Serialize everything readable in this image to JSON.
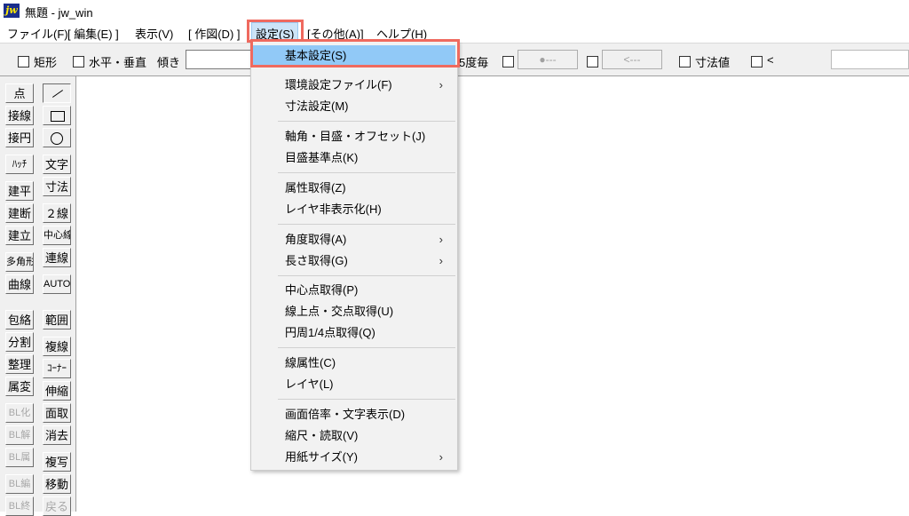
{
  "window": {
    "title": "無題 - jw_win",
    "icon": "jw-app-icon",
    "icon_text": "jw"
  },
  "menubar": {
    "items": [
      {
        "label": "ファイル(F)"
      },
      {
        "label": "[ 編集(E) ]"
      },
      {
        "label": "表示(V)"
      },
      {
        "label": "[ 作図(D) ]"
      },
      {
        "label": "設定(S)"
      },
      {
        "label": "[その他(A)]"
      },
      {
        "label": "ヘルプ(H)"
      }
    ]
  },
  "toolbar": {
    "rect_label": "矩形",
    "hv_label": "水平・垂直",
    "tilt_label": "傾き",
    "deg15_label": "5度毎",
    "btn_dot": "●---",
    "btn_arrow": "<---",
    "dim_label": "寸法値",
    "lt_label": "<"
  },
  "sidebar": {
    "col1": [
      "点",
      "接線",
      "接円",
      "ﾊｯﾁ",
      "建平",
      "建断",
      "建立",
      "多角形",
      "曲線",
      "包絡",
      "分割",
      "整理",
      "属変",
      "BL化",
      "BL解",
      "BL属",
      "BL編",
      "BL終"
    ],
    "col2": [
      "",
      "",
      "",
      "文字",
      "寸法",
      "２線",
      "中心線",
      "連線",
      "AUTO",
      "範囲",
      "複線",
      "ｺｰﾅｰ",
      "伸縮",
      "面取",
      "消去",
      "複写",
      "移動",
      "戻る"
    ]
  },
  "dropdown": {
    "items": [
      {
        "label": "基本設定(S)",
        "submenu": false,
        "selected": true
      },
      {
        "label": "環境設定ファイル(F)",
        "submenu": true
      },
      {
        "label": "寸法設定(M)",
        "submenu": false
      },
      {
        "label": "軸角・目盛・オフセット(J)",
        "submenu": false
      },
      {
        "label": "目盛基準点(K)",
        "submenu": false
      },
      {
        "label": "属性取得(Z)",
        "submenu": false
      },
      {
        "label": "レイヤ非表示化(H)",
        "submenu": false
      },
      {
        "label": "角度取得(A)",
        "submenu": true
      },
      {
        "label": "長さ取得(G)",
        "submenu": true
      },
      {
        "label": "中心点取得(P)",
        "submenu": false
      },
      {
        "label": "線上点・交点取得(U)",
        "submenu": false
      },
      {
        "label": "円周1/4点取得(Q)",
        "submenu": false
      },
      {
        "label": "線属性(C)",
        "submenu": false
      },
      {
        "label": "レイヤ(L)",
        "submenu": false
      },
      {
        "label": "画面倍率・文字表示(D)",
        "submenu": false
      },
      {
        "label": "縮尺・読取(V)",
        "submenu": false
      },
      {
        "label": "用紙サイズ(Y)",
        "submenu": true
      }
    ],
    "submenu_arrow": "›"
  },
  "colors": {
    "highlight_box": "#ef6a5f",
    "selected_item": "#91c9f7",
    "menu_active": "#cce4f7"
  }
}
